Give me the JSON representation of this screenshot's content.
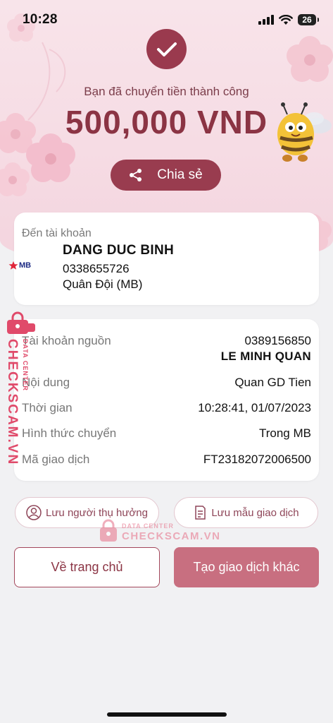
{
  "status_bar": {
    "time": "10:28",
    "battery": "26"
  },
  "hero": {
    "success_text": "Bạn đã chuyển tiền thành công",
    "amount": "500,000 VND",
    "share_label": "Chia sẻ"
  },
  "destination": {
    "label": "Đến tài khoản",
    "bank_logo_text": "MB",
    "name": "DANG DUC BINH",
    "account": "0338655726",
    "bank": "Quân Đội (MB)"
  },
  "details": {
    "source_label": "Tài khoản nguồn",
    "source_account": "0389156850",
    "source_name": "LE MINH QUAN",
    "content_label": "Nội dung",
    "content_value": "Quan GD Tien",
    "time_label": "Thời gian",
    "time_value": "10:28:41, 01/07/2023",
    "method_label": "Hình thức chuyển",
    "method_value": "Trong MB",
    "txn_label": "Mã giao dịch",
    "txn_value": "FT23182072006500"
  },
  "actions": {
    "save_beneficiary": "Lưu người thụ hưởng",
    "save_template": "Lưu mẫu giao dịch",
    "home": "Về trang chủ",
    "new_transaction": "Tạo giao dịch khác"
  },
  "watermark": {
    "brand": "CHECKSCAM.VN",
    "sub": "DATA CENTER"
  },
  "colors": {
    "primary": "#993c4f",
    "accent_light": "#c86f80",
    "watermark": "#e04a6a"
  }
}
